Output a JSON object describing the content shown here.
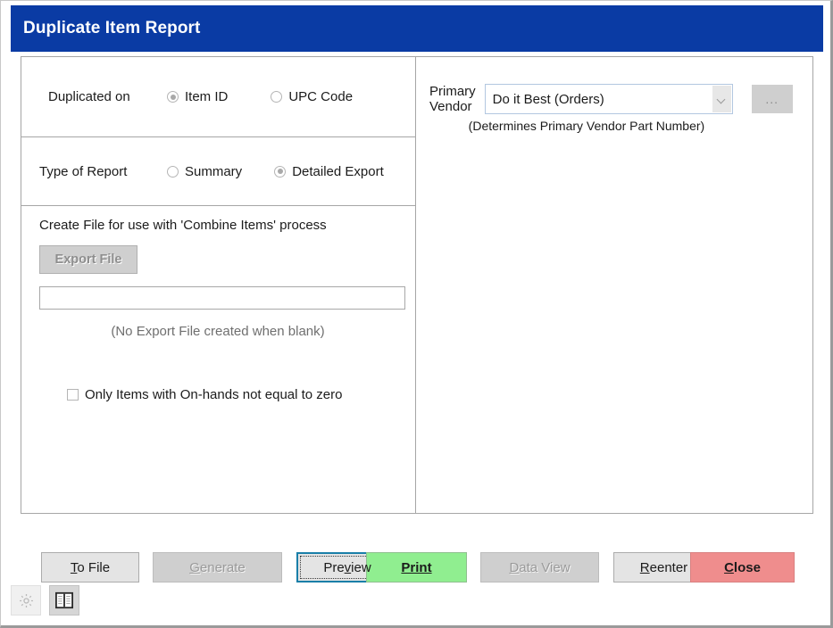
{
  "window": {
    "title": "Duplicate Item Report",
    "title_bar_color": "#0a3ba4"
  },
  "left_panel": {
    "duplicated_on": {
      "label": "Duplicated on",
      "options": [
        {
          "label": "Item ID",
          "selected": true
        },
        {
          "label": "UPC Code",
          "selected": false
        }
      ]
    },
    "type_of_report": {
      "label": "Type of Report",
      "options": [
        {
          "label": "Summary",
          "selected": false
        },
        {
          "label": "Detailed Export",
          "selected": true
        }
      ]
    },
    "export": {
      "heading": "Create File for use with 'Combine Items' process",
      "button_label": "Export File",
      "file_value": "",
      "file_placeholder": "",
      "hint": "(No Export File created when blank)"
    },
    "onhand_filter": {
      "label": "Only Items with On-hands not equal to zero",
      "checked": false
    }
  },
  "right_panel": {
    "primary_vendor": {
      "label_line1": "Primary",
      "label_line2": "Vendor",
      "value": "Do it Best (Orders)",
      "browse_label": "...",
      "hint": "(Determines Primary Vendor Part Number)"
    }
  },
  "buttons": [
    {
      "name": "to-file",
      "label": "To File",
      "accel": "T",
      "state": "normal",
      "color": "#e4e4e4"
    },
    {
      "name": "generate",
      "label": "Generate",
      "accel": "G",
      "state": "disabled",
      "color": "#cfcfcf"
    },
    {
      "name": "preview",
      "label": "Preview",
      "accel": "v",
      "state": "focused",
      "color": "#90ee90"
    },
    {
      "name": "print",
      "label": "Print",
      "accel": "P",
      "state": "green",
      "color": "#90ee90"
    },
    {
      "name": "data-view",
      "label": "Data View",
      "accel": "D",
      "state": "disabled",
      "color": "#cfcfcf"
    },
    {
      "name": "reenter",
      "label": "Reenter",
      "accel": "R",
      "state": "normal",
      "color": "#e4e4e4"
    },
    {
      "name": "close",
      "label": "Close",
      "accel": "C",
      "state": "red",
      "color": "#ef8d8d"
    }
  ],
  "icon_bar": [
    {
      "name": "gear-icon",
      "label": "Settings"
    },
    {
      "name": "book-icon",
      "label": "Notes"
    }
  ]
}
